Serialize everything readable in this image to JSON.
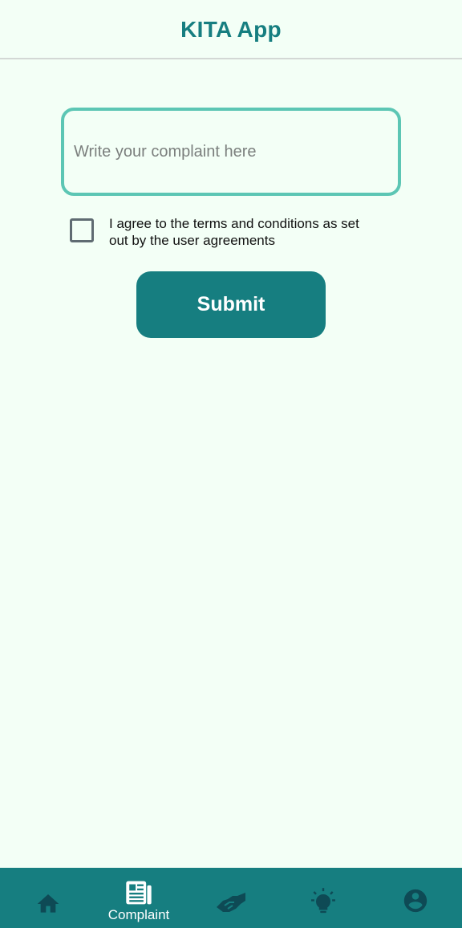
{
  "header": {
    "title": "KITA App"
  },
  "form": {
    "complaint_placeholder": "Write your complaint here",
    "agree_text": "I agree to the terms and conditions as set out by the user agreements",
    "submit_label": "Submit"
  },
  "bottom_nav": {
    "items": [
      {
        "icon": "home-icon",
        "label": ""
      },
      {
        "icon": "newspaper-icon",
        "label": "Complaint",
        "active": true
      },
      {
        "icon": "handshake-icon",
        "label": ""
      },
      {
        "icon": "lightbulb-icon",
        "label": ""
      },
      {
        "icon": "account-circle-icon",
        "label": ""
      }
    ]
  },
  "colors": {
    "primary": "#167e80",
    "accent_border": "#5cc6b4",
    "background": "#f3fff6",
    "icon_inactive": "#0e4a55",
    "icon_active": "#ffffff"
  }
}
